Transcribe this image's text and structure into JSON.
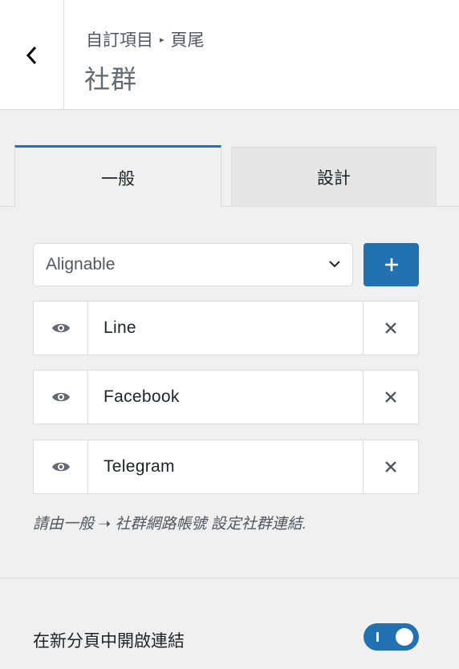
{
  "header": {
    "breadcrumb_parent": "自訂項目",
    "breadcrumb_child": "頁尾",
    "title": "社群"
  },
  "tabs": [
    {
      "label": "一般",
      "active": true
    },
    {
      "label": "設計",
      "active": false
    }
  ],
  "network_select": {
    "value": "Alignable"
  },
  "add_button": {
    "icon": "plus-icon"
  },
  "items": [
    {
      "label": "Line",
      "visible": true
    },
    {
      "label": "Facebook",
      "visible": true
    },
    {
      "label": "Telegram",
      "visible": true
    }
  ],
  "hint": "請由一般 ➝ 社群網路帳號 設定社群連結.",
  "open_new_tab": {
    "label": "在新分頁中開啟連結",
    "enabled": true
  },
  "colors": {
    "accent": "#2271b1",
    "background": "#f0f0f1"
  }
}
